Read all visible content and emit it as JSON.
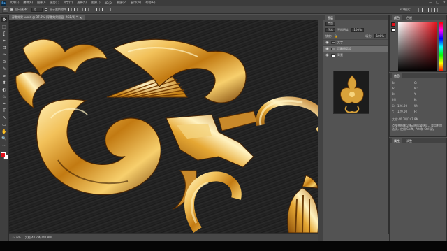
{
  "app": {
    "logo": "Ps"
  },
  "menu": [
    "文件(F)",
    "编辑(E)",
    "图像(I)",
    "图层(L)",
    "文字(Y)",
    "选择(S)",
    "滤镜(T)",
    "3D(D)",
    "视图(V)",
    "窗口(W)",
    "帮助(H)"
  ],
  "window_controls": {
    "minimize": "—",
    "maximize": "□",
    "close": "✕"
  },
  "options": {
    "auto_select_label": "自动选择：",
    "auto_select_value": "组",
    "show_transform_label": "显示变换控件",
    "mode_3d_label": "3D 模式："
  },
  "document": {
    "tab_title": "浮雕效果 Luxid @ 37.6% (浮雕效果图层, RGB/8) *",
    "tab_close": "✕",
    "status_zoom": "37.6%",
    "status_doc": "文档:40.7M/247.8M"
  },
  "tools": [
    "✥",
    "⬚",
    "ʆ",
    "⌖",
    "⊡",
    "✑",
    "⊙",
    "✎",
    "⌀",
    "⬍",
    "◐",
    "♨",
    "✒",
    "T",
    "↖",
    "▭",
    "✋",
    "🔍",
    "⋯"
  ],
  "layers_panel": {
    "tab": "图层",
    "kind_label": "类型",
    "blend_mode": "正常",
    "opacity_label": "不透明度:",
    "opacity_value": "100%",
    "lock_label": "锁定:",
    "fill_label": "填充:",
    "fill_value": "100%",
    "layers": [
      {
        "name": "文字",
        "type": "folder",
        "visible": true,
        "selected": false
      },
      {
        "name": "浮雕图层组",
        "type": "folder",
        "visible": true,
        "selected": true
      },
      {
        "name": "背景",
        "type": "layer",
        "visible": true,
        "selected": false
      }
    ]
  },
  "color_panel": {
    "tabs": [
      "颜色",
      "色板"
    ],
    "fg": "#e2101a",
    "bg": "#ffffff"
  },
  "info_panel": {
    "tabs": [
      "信息"
    ],
    "rows": [
      {
        "k1": "R:",
        "v1": "",
        "k2": "C:",
        "v2": ""
      },
      {
        "k1": "G:",
        "v1": "",
        "k2": "M:",
        "v2": ""
      },
      {
        "k1": "B:",
        "v1": "",
        "k2": "Y:",
        "v2": ""
      },
      {
        "k1": "8位",
        "v1": "",
        "k2": "K:",
        "v2": ""
      },
      {
        "k1": "X:",
        "v1": "126.00",
        "k2": "W:",
        "v2": ""
      },
      {
        "k1": "Y:",
        "v1": "129.00",
        "k2": "H:",
        "v2": ""
      }
    ],
    "doc_size": "文档:40.7M/247.8M",
    "hint": "点按并拖移以移动图层或选区。要用附加选项，使用 Shift、Alt 和 Ctrl 键。"
  },
  "properties_panel": {
    "tabs": [
      "属性",
      "调整"
    ]
  },
  "colors": {
    "gold": "#d89a2a",
    "canvas": "#1e1e1e",
    "accent_red": "#e2101a"
  }
}
